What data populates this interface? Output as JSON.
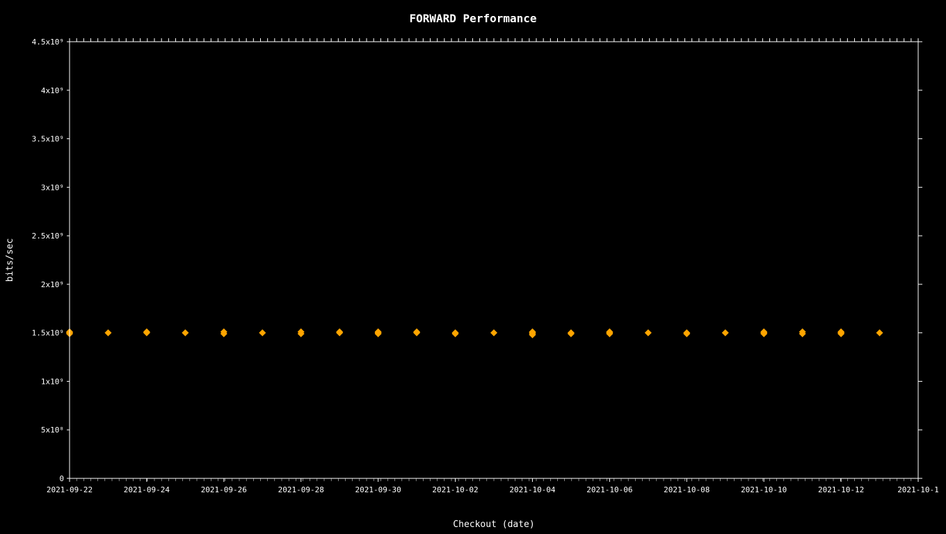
{
  "chart": {
    "title": "FORWARD Performance",
    "x_axis_label": "Checkout (date)",
    "y_axis_label": "bits/sec",
    "y_ticks": [
      {
        "label": "0",
        "value": 0
      },
      {
        "label": "5x10⁸",
        "value": 500000000
      },
      {
        "label": "1x10⁹",
        "value": 1000000000
      },
      {
        "label": "1.5x10⁹",
        "value": 1500000000
      },
      {
        "label": "2x10⁹",
        "value": 2000000000
      },
      {
        "label": "2.5x10⁹",
        "value": 2500000000
      },
      {
        "label": "3x10⁹",
        "value": 3000000000
      },
      {
        "label": "3.5x10⁹",
        "value": 3500000000
      },
      {
        "label": "4x10⁹",
        "value": 4000000000
      },
      {
        "label": "4.5x10⁹",
        "value": 4500000000
      }
    ],
    "x_ticks": [
      "2021-09-22",
      "2021-09-24",
      "2021-09-26",
      "2021-09-28",
      "2021-09-30",
      "2021-10-02",
      "2021-10-04",
      "2021-10-06",
      "2021-10-08",
      "2021-10-10",
      "2021-10-12",
      "2021-10-1"
    ],
    "data_color": "#FFA500",
    "dot_groups": [
      {
        "x_label": "2021-09-22",
        "values": [
          1490000000.0,
          1500000000.0,
          1510000000.0
        ]
      },
      {
        "x_label": "2021-09-23",
        "values": [
          1500000000.0
        ]
      },
      {
        "x_label": "2021-09-24",
        "values": [
          1500000000.0,
          1510000000.0
        ]
      },
      {
        "x_label": "2021-09-25",
        "values": [
          1500000000.0
        ]
      },
      {
        "x_label": "2021-09-26",
        "values": [
          1490000000.0,
          1510000000.0
        ]
      },
      {
        "x_label": "2021-09-27",
        "values": [
          1500000000.0
        ]
      },
      {
        "x_label": "2021-09-28",
        "values": [
          1490000000.0,
          1510000000.0
        ]
      },
      {
        "x_label": "2021-09-29",
        "values": [
          1500000000.0,
          1510000000.0
        ]
      },
      {
        "x_label": "2021-09-30",
        "values": [
          1490000000.0,
          1500000000.0,
          1510000000.0
        ]
      },
      {
        "x_label": "2021-10-01",
        "values": [
          1500000000.0,
          1510000000.0
        ]
      },
      {
        "x_label": "2021-10-02",
        "values": [
          1490000000.0,
          1500000000.0
        ]
      },
      {
        "x_label": "2021-10-03",
        "values": [
          1500000000.0
        ]
      },
      {
        "x_label": "2021-10-04",
        "values": [
          1480000000.0,
          1490000000.0,
          1500000000.0,
          1510000000.0
        ]
      },
      {
        "x_label": "2021-10-05",
        "values": [
          1490000000.0,
          1500000000.0
        ]
      },
      {
        "x_label": "2021-10-06",
        "values": [
          1490000000.0,
          1500000000.0,
          1510000000.0
        ]
      },
      {
        "x_label": "2021-10-07",
        "values": [
          1500000000.0
        ]
      },
      {
        "x_label": "2021-10-08",
        "values": [
          1490000000.0,
          1500000000.0
        ]
      },
      {
        "x_label": "2021-10-09",
        "values": [
          1500000000.0
        ]
      },
      {
        "x_label": "2021-10-10",
        "values": [
          1490000000.0,
          1500000000.0,
          1510000000.0
        ]
      },
      {
        "x_label": "2021-10-11",
        "values": [
          1490000000.0,
          1510000000.0
        ]
      },
      {
        "x_label": "2021-10-12",
        "values": [
          1490000000.0,
          1500000000.0,
          1510000000.0
        ]
      },
      {
        "x_label": "2021-10-13",
        "values": [
          1500000000.0
        ]
      }
    ]
  }
}
